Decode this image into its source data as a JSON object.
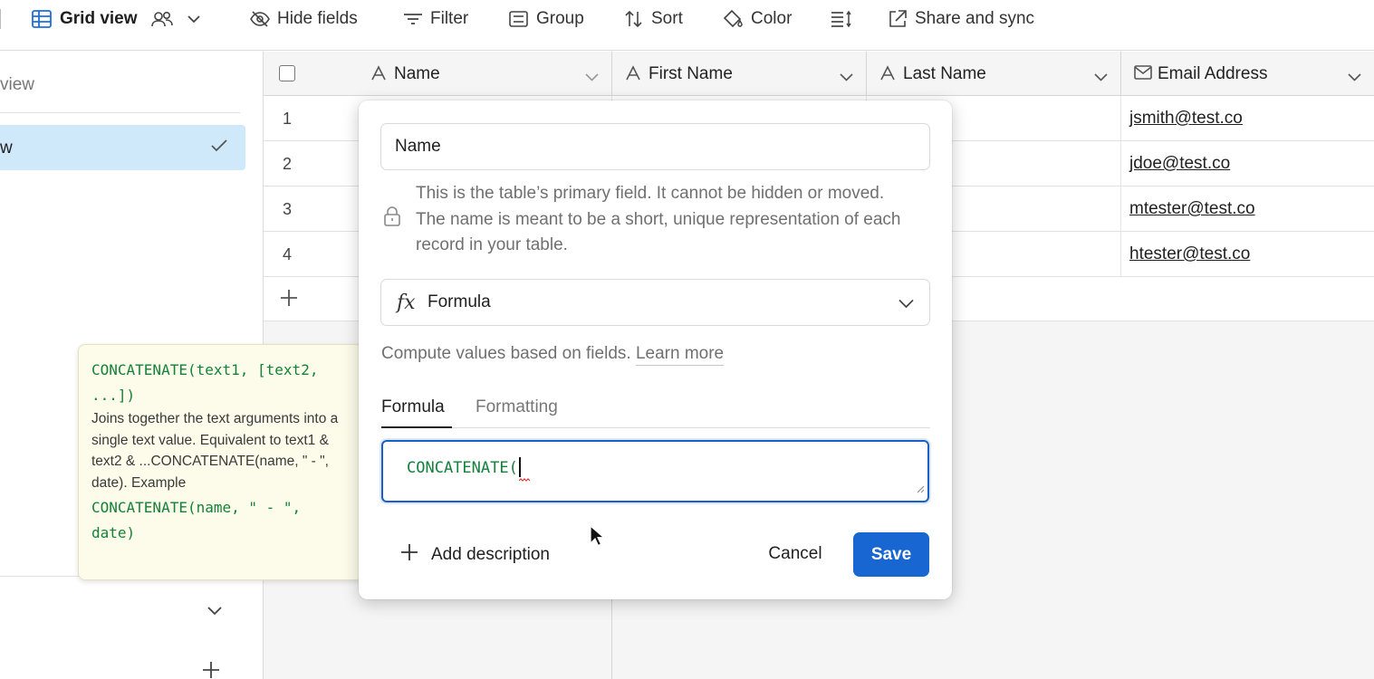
{
  "toolbar": {
    "view_name": "Grid view",
    "hide_fields": "Hide fields",
    "filter": "Filter",
    "group": "Group",
    "sort": "Sort",
    "color": "Color",
    "share_sync": "Share and sync"
  },
  "sidebar": {
    "find_view": "view",
    "active_view": "w"
  },
  "grid": {
    "columns": [
      {
        "label": "Name",
        "icon": "text-icon"
      },
      {
        "label": "First Name",
        "icon": "text-icon"
      },
      {
        "label": "Last Name",
        "icon": "text-icon"
      },
      {
        "label": "Email Address",
        "icon": "email-icon"
      }
    ],
    "rows": [
      {
        "num": "1",
        "email": "jsmith@test.co"
      },
      {
        "num": "2",
        "email": "jdoe@test.co"
      },
      {
        "num": "3",
        "email": "mtester@test.co"
      },
      {
        "num": "4",
        "email": "htester@test.co"
      }
    ]
  },
  "tooltip": {
    "signature_1": "CONCATENATE(text1, [text2,",
    "signature_2": "...])",
    "description": "Joins together the text arguments into a single text value. Equivalent to text1 & text2 & ...CONCATENATE(name, \" - \", date). Example",
    "example_1": "CONCATENATE(name, \" - \",",
    "example_2": "date)"
  },
  "dialog": {
    "field_name": "Name",
    "primary_note": "This is the table’s primary field. It cannot be hidden or moved. The name is meant to be a short, unique representation of each record in your table.",
    "field_type": "Formula",
    "field_type_icon": "fx",
    "compute_note": "Compute values based on fields.",
    "learn_more": "Learn more",
    "tabs": [
      "Formula",
      "Formatting"
    ],
    "formula_value": "CONCATENATE(",
    "add_description": "Add description",
    "cancel": "Cancel",
    "save": "Save"
  },
  "colors": {
    "accent": "#1766d1",
    "formula_green": "#13823a",
    "selected_view_bg": "#cfe9fb",
    "tooltip_bg": "#fdfbe9"
  }
}
